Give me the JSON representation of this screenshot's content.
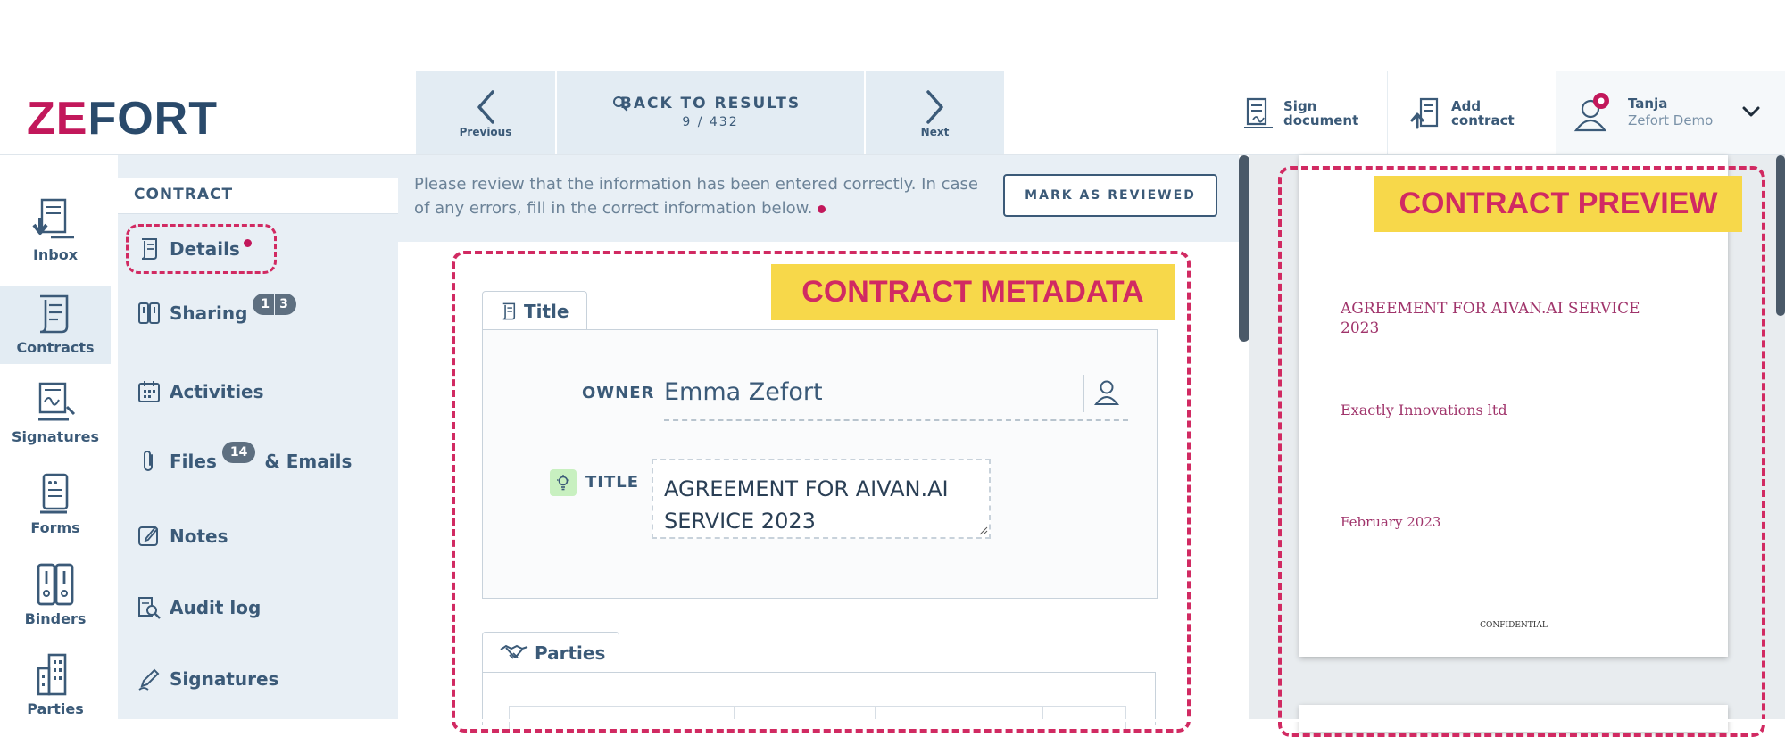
{
  "app": {
    "logo_part1": "ZE",
    "logo_part2": "FORT"
  },
  "colors": {
    "brand_magenta": "#c2185b",
    "brand_navy": "#2a4a6b",
    "annotation_yellow": "#f7d84a",
    "annotation_red": "#d12a62"
  },
  "topnav": {
    "previous_label": "Previous",
    "back_label": "BACK TO RESULTS",
    "result_position": "9 / 432",
    "next_label": "Next",
    "sign_document_line1": "Sign",
    "sign_document_line2": "document",
    "add_contract_line1": "Add",
    "add_contract_line2": "contract",
    "user_name": "Tanja",
    "user_org": "Zefort Demo"
  },
  "rail": {
    "items": [
      {
        "label": "Inbox",
        "icon": "inbox-icon"
      },
      {
        "label": "Contracts",
        "icon": "contract-scroll-icon"
      },
      {
        "label": "Signatures",
        "icon": "signature-icon"
      },
      {
        "label": "Forms",
        "icon": "form-icon"
      },
      {
        "label": "Binders",
        "icon": "binder-icon"
      },
      {
        "label": "Parties",
        "icon": "building-icon"
      }
    ]
  },
  "subnav": {
    "heading": "CONTRACT",
    "details": "Details",
    "sharing": "Sharing",
    "sharing_badge_a": "1",
    "sharing_badge_b": "3",
    "activities": "Activities",
    "files": "Files",
    "files_badge": "14",
    "emails": "& Emails",
    "notes": "Notes",
    "audit_log": "Audit log",
    "signatures": "Signatures"
  },
  "banner": {
    "text": "Please review that the information has been entered correctly. In case of any errors, fill in the correct information below.",
    "mark_reviewed": "MARK AS REVIEWED"
  },
  "annotations": {
    "metadata": "CONTRACT METADATA",
    "preview": "CONTRACT PREVIEW"
  },
  "form": {
    "title_tab": "Title",
    "owner_label": "OWNER",
    "owner_value": "Emma Zefort",
    "title_label": "TITLE",
    "title_value": "AGREEMENT FOR AIVAN.AI SERVICE 2023",
    "parties_tab": "Parties"
  },
  "preview": {
    "doc_title": "AGREEMENT FOR AIVAN.AI SERVICE 2023",
    "party": "Exactly Innovations ltd",
    "date": "February 2023",
    "confidential": "CONFIDENTIAL"
  }
}
